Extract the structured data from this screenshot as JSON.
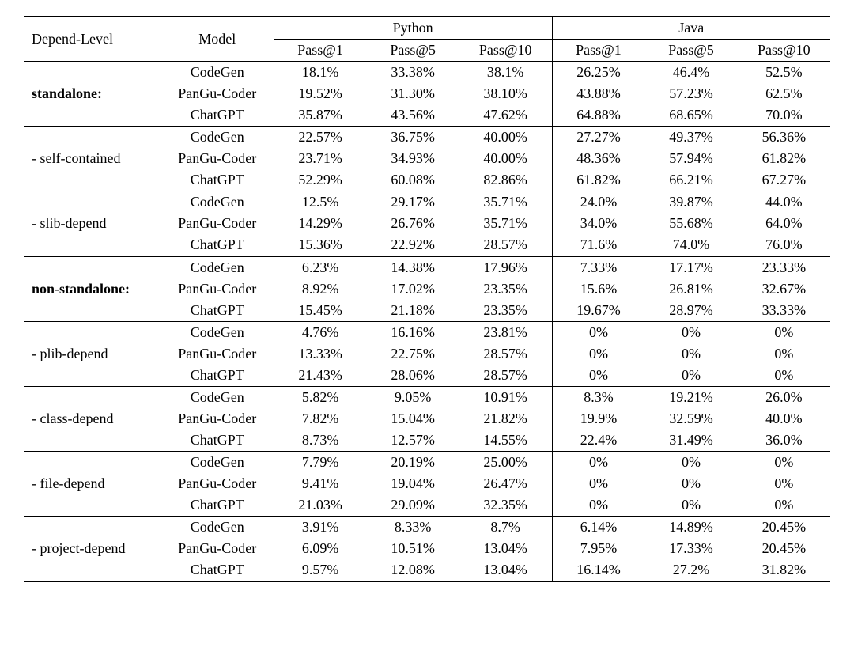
{
  "headers": {
    "depend_level": "Depend-Level",
    "model": "Model",
    "python": "Python",
    "java": "Java",
    "pass1": "Pass@1",
    "pass5": "Pass@5",
    "pass10": "Pass@10"
  },
  "groups": [
    {
      "label": "standalone:",
      "bold": true,
      "top_rule": "thin",
      "rows": [
        {
          "model": "CodeGen",
          "py_p1": "18.1%",
          "py_p5": "33.38%",
          "py_p10": "38.1%",
          "jv_p1": "26.25%",
          "jv_p5": "46.4%",
          "jv_p10": "52.5%"
        },
        {
          "model": "PanGu-Coder",
          "py_p1": "19.52%",
          "py_p5": "31.30%",
          "py_p10": "38.10%",
          "jv_p1": "43.88%",
          "jv_p5": "57.23%",
          "jv_p10": "62.5%"
        },
        {
          "model": "ChatGPT",
          "py_p1": "35.87%",
          "py_p5": "43.56%",
          "py_p10": "47.62%",
          "jv_p1": "64.88%",
          "jv_p5": "68.65%",
          "jv_p10": "70.0%"
        }
      ]
    },
    {
      "label": "- self-contained",
      "bold": false,
      "top_rule": "thin",
      "rows": [
        {
          "model": "CodeGen",
          "py_p1": "22.57%",
          "py_p5": "36.75%",
          "py_p10": "40.00%",
          "jv_p1": "27.27%",
          "jv_p5": "49.37%",
          "jv_p10": "56.36%"
        },
        {
          "model": "PanGu-Coder",
          "py_p1": "23.71%",
          "py_p5": "34.93%",
          "py_p10": "40.00%",
          "jv_p1": "48.36%",
          "jv_p5": "57.94%",
          "jv_p10": "61.82%"
        },
        {
          "model": "ChatGPT",
          "py_p1": "52.29%",
          "py_p5": "60.08%",
          "py_p10": "82.86%",
          "jv_p1": "61.82%",
          "jv_p5": "66.21%",
          "jv_p10": "67.27%"
        }
      ]
    },
    {
      "label": "- slib-depend",
      "bold": false,
      "top_rule": "thin",
      "rows": [
        {
          "model": "CodeGen",
          "py_p1": "12.5%",
          "py_p5": "29.17%",
          "py_p10": "35.71%",
          "jv_p1": "24.0%",
          "jv_p5": "39.87%",
          "jv_p10": "44.0%"
        },
        {
          "model": "PanGu-Coder",
          "py_p1": "14.29%",
          "py_p5": "26.76%",
          "py_p10": "35.71%",
          "jv_p1": "34.0%",
          "jv_p5": "55.68%",
          "jv_p10": "64.0%"
        },
        {
          "model": "ChatGPT",
          "py_p1": "15.36%",
          "py_p5": "22.92%",
          "py_p10": "28.57%",
          "jv_p1": "71.6%",
          "jv_p5": "74.0%",
          "jv_p10": "76.0%"
        }
      ]
    },
    {
      "label": "non-standalone:",
      "bold": true,
      "top_rule": "thick",
      "rows": [
        {
          "model": "CodeGen",
          "py_p1": "6.23%",
          "py_p5": "14.38%",
          "py_p10": "17.96%",
          "jv_p1": "7.33%",
          "jv_p5": "17.17%",
          "jv_p10": "23.33%"
        },
        {
          "model": "PanGu-Coder",
          "py_p1": "8.92%",
          "py_p5": "17.02%",
          "py_p10": "23.35%",
          "jv_p1": "15.6%",
          "jv_p5": "26.81%",
          "jv_p10": "32.67%"
        },
        {
          "model": "ChatGPT",
          "py_p1": "15.45%",
          "py_p5": "21.18%",
          "py_p10": "23.35%",
          "jv_p1": "19.67%",
          "jv_p5": "28.97%",
          "jv_p10": "33.33%"
        }
      ]
    },
    {
      "label": "- plib-depend",
      "bold": false,
      "top_rule": "thin",
      "rows": [
        {
          "model": "CodeGen",
          "py_p1": "4.76%",
          "py_p5": "16.16%",
          "py_p10": "23.81%",
          "jv_p1": "0%",
          "jv_p5": "0%",
          "jv_p10": "0%"
        },
        {
          "model": "PanGu-Coder",
          "py_p1": "13.33%",
          "py_p5": "22.75%",
          "py_p10": "28.57%",
          "jv_p1": "0%",
          "jv_p5": "0%",
          "jv_p10": "0%"
        },
        {
          "model": "ChatGPT",
          "py_p1": "21.43%",
          "py_p5": "28.06%",
          "py_p10": "28.57%",
          "jv_p1": "0%",
          "jv_p5": "0%",
          "jv_p10": "0%"
        }
      ]
    },
    {
      "label": "- class-depend",
      "bold": false,
      "top_rule": "thin",
      "rows": [
        {
          "model": "CodeGen",
          "py_p1": "5.82%",
          "py_p5": "9.05%",
          "py_p10": "10.91%",
          "jv_p1": "8.3%",
          "jv_p5": "19.21%",
          "jv_p10": "26.0%"
        },
        {
          "model": "PanGu-Coder",
          "py_p1": "7.82%",
          "py_p5": "15.04%",
          "py_p10": "21.82%",
          "jv_p1": "19.9%",
          "jv_p5": "32.59%",
          "jv_p10": "40.0%"
        },
        {
          "model": "ChatGPT",
          "py_p1": "8.73%",
          "py_p5": "12.57%",
          "py_p10": "14.55%",
          "jv_p1": "22.4%",
          "jv_p5": "31.49%",
          "jv_p10": "36.0%"
        }
      ]
    },
    {
      "label": "- file-depend",
      "bold": false,
      "top_rule": "thin",
      "rows": [
        {
          "model": "CodeGen",
          "py_p1": "7.79%",
          "py_p5": "20.19%",
          "py_p10": "25.00%",
          "jv_p1": "0%",
          "jv_p5": "0%",
          "jv_p10": "0%"
        },
        {
          "model": "PanGu-Coder",
          "py_p1": "9.41%",
          "py_p5": "19.04%",
          "py_p10": "26.47%",
          "jv_p1": "0%",
          "jv_p5": "0%",
          "jv_p10": "0%"
        },
        {
          "model": "ChatGPT",
          "py_p1": "21.03%",
          "py_p5": "29.09%",
          "py_p10": "32.35%",
          "jv_p1": "0%",
          "jv_p5": "0%",
          "jv_p10": "0%"
        }
      ]
    },
    {
      "label": "- project-depend",
      "bold": false,
      "top_rule": "thin",
      "rows": [
        {
          "model": "CodeGen",
          "py_p1": "3.91%",
          "py_p5": "8.33%",
          "py_p10": "8.7%",
          "jv_p1": "6.14%",
          "jv_p5": "14.89%",
          "jv_p10": "20.45%"
        },
        {
          "model": "PanGu-Coder",
          "py_p1": "6.09%",
          "py_p5": "10.51%",
          "py_p10": "13.04%",
          "jv_p1": "7.95%",
          "jv_p5": "17.33%",
          "jv_p10": "20.45%"
        },
        {
          "model": "ChatGPT",
          "py_p1": "9.57%",
          "py_p5": "12.08%",
          "py_p10": "13.04%",
          "jv_p1": "16.14%",
          "jv_p5": "27.2%",
          "jv_p10": "31.82%"
        }
      ]
    }
  ]
}
